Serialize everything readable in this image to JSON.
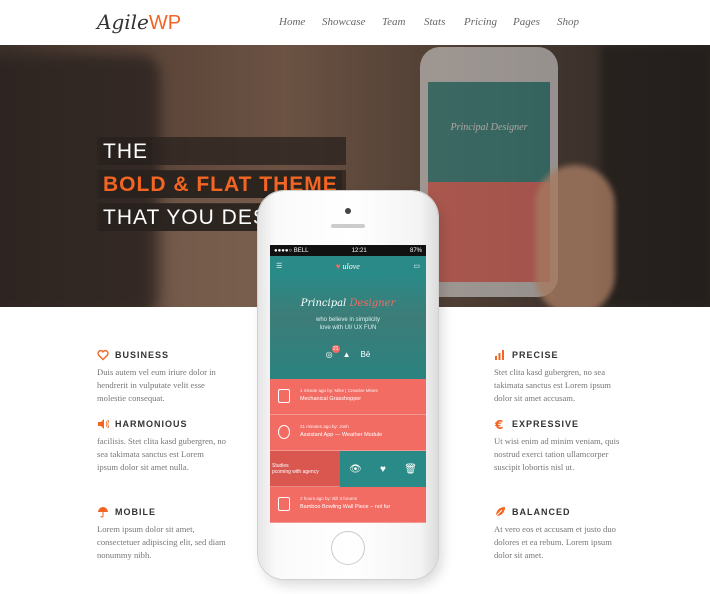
{
  "logo": {
    "text": "Agile",
    "suffix": "WP"
  },
  "nav": [
    "Home",
    "Showcase",
    "Team",
    "Stats",
    "Pricing",
    "Pages",
    "Shop"
  ],
  "headline": {
    "line1": "THE",
    "line2": "BOLD & FLAT THEME",
    "line3": "THAT YOU DESERVE"
  },
  "features_left": [
    {
      "title": "BUSINESS",
      "icon": "heart-icon",
      "text": "Duis autem vel eum iriure dolor in hendrerit in vulputate velit esse molestie consequat."
    },
    {
      "title": "HARMONIOUS",
      "icon": "speaker-icon",
      "text": "facilisis. Stet clita kasd gubergren, no sea takimata sanctus est Lorem ipsum dolor sit amet nulla."
    },
    {
      "title": "MOBILE",
      "icon": "umbrella-icon",
      "text": "Lorem ipsum dolor sit amet, consectetuer adipiscing elit, sed diam nonummy nibh."
    }
  ],
  "features_right": [
    {
      "title": "PRECISE",
      "icon": "bars-icon",
      "text": "Stet clita kasd gubergren, no sea takimata sanctus est Lorem ipsum dolor sit amet accusam."
    },
    {
      "title": "EXPRESSIVE",
      "icon": "euro-icon",
      "text": "Ut wisi enim ad minim veniam, quis nostrud exerci tation ullamcorper suscipit lobortis nisl ut."
    },
    {
      "title": "BALANCED",
      "icon": "leaf-icon",
      "text": "At vero eos et accusam et justo duo dolores et ea rebum. Lorem ipsum dolor sit amet."
    }
  ],
  "phone": {
    "carrier": "●●●●○ BELL",
    "time": "12:21",
    "battery": "87%",
    "brand": "ulove",
    "title_a": "Principal ",
    "title_b": "Designer",
    "sub1": "who believe in simplicity",
    "sub2": "love with UI/ UX FUN",
    "dribbble_count": "21",
    "behance": "Bē",
    "bg_title": "Principal Designer",
    "feed": [
      {
        "meta": "1 minute ago   by: Mike | Creative Mines",
        "msg": "Mechanical Grasshopper"
      },
      {
        "meta": "21 minutes ago   by: Josh",
        "msg": "Assistant App — Weather Module"
      },
      {
        "meta": "Studies",
        "msg": "pcoming with agency"
      },
      {
        "meta": "2 hours ago   by: Bill 3 forums",
        "msg": "Bamboo Bowling Wall Piece – not fur"
      }
    ]
  }
}
